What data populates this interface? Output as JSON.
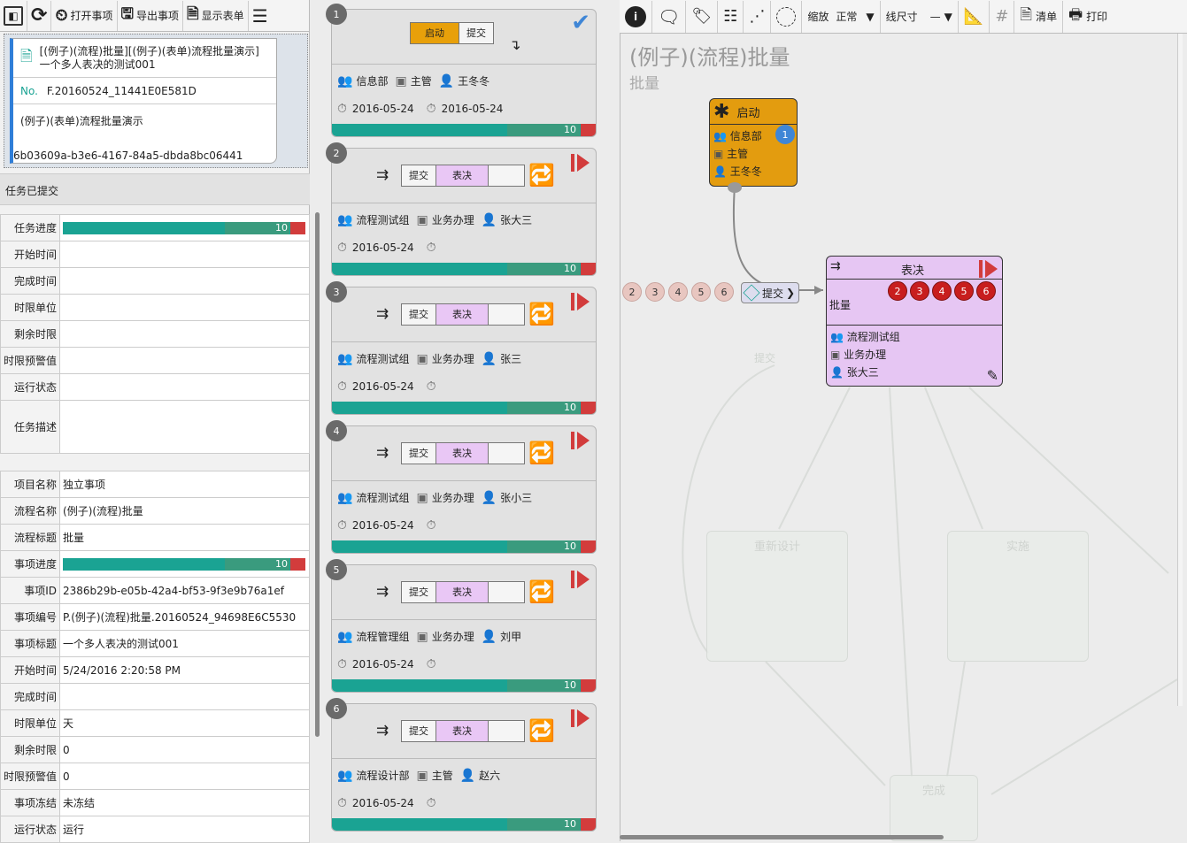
{
  "toolbar": {
    "open": "打开事项",
    "export": "导出事项",
    "show_form": "显示表单"
  },
  "info": {
    "title": "[(例子)(流程)批量][(例子)(表单)流程批量演示]一个多人表决的测试001",
    "no_label": "No.",
    "no": "F.20160524_11441E0E581D",
    "form_name": "(例子)(表单)流程批量演示",
    "guid": "6b03609a-b3e6-4167-84a5-dbda8bc06441"
  },
  "task_status": "任务已提交",
  "task_table": [
    {
      "k": "任务进度",
      "v": "",
      "progress": 10
    },
    {
      "k": "开始时间",
      "v": ""
    },
    {
      "k": "完成时间",
      "v": ""
    },
    {
      "k": "时限单位",
      "v": ""
    },
    {
      "k": "剩余时限",
      "v": ""
    },
    {
      "k": "时限预警值",
      "v": ""
    },
    {
      "k": "运行状态",
      "v": ""
    },
    {
      "k": "任务描述",
      "v": ""
    }
  ],
  "item_table": [
    {
      "k": "项目名称",
      "v": "独立事项"
    },
    {
      "k": "流程名称",
      "v": "(例子)(流程)批量"
    },
    {
      "k": "流程标题",
      "v": "批量"
    },
    {
      "k": "事项进度",
      "v": "",
      "progress": 10
    },
    {
      "k": "事项ID",
      "v": "2386b29b-e05b-42a4-bf53-9f3e9b76a1ef"
    },
    {
      "k": "事项编号",
      "v": "P.(例子)(流程)批量.20160524_94698E6C5530"
    },
    {
      "k": "事项标题",
      "v": "一个多人表决的测试001"
    },
    {
      "k": "开始时间",
      "v": "5/24/2016 2:20:58 PM"
    },
    {
      "k": "完成时间",
      "v": ""
    },
    {
      "k": "时限单位",
      "v": "天"
    },
    {
      "k": "剩余时限",
      "v": "0"
    },
    {
      "k": "时限预警值",
      "v": "0"
    },
    {
      "k": "事项冻结",
      "v": "未冻结"
    },
    {
      "k": "运行状态",
      "v": "运行"
    }
  ],
  "cards": [
    {
      "n": "1",
      "steps": [
        "启动",
        "提交"
      ],
      "dept": "信息部",
      "role": "主管",
      "user": "王冬冬",
      "start": "2016-05-24",
      "end": "2016-05-24",
      "progress": "10",
      "first": true
    },
    {
      "n": "2",
      "steps": [
        "提交",
        "表决",
        ""
      ],
      "dept": "流程测试组",
      "role": "业务办理",
      "user": "张大三",
      "start": "2016-05-24",
      "end": "",
      "progress": "10"
    },
    {
      "n": "3",
      "steps": [
        "提交",
        "表决",
        ""
      ],
      "dept": "流程测试组",
      "role": "业务办理",
      "user": "张三",
      "start": "2016-05-24",
      "end": "",
      "progress": "10"
    },
    {
      "n": "4",
      "steps": [
        "提交",
        "表决",
        ""
      ],
      "dept": "流程测试组",
      "role": "业务办理",
      "user": "张小三",
      "start": "2016-05-24",
      "end": "",
      "progress": "10"
    },
    {
      "n": "5",
      "steps": [
        "提交",
        "表决",
        ""
      ],
      "dept": "流程管理组",
      "role": "业务办理",
      "user": "刘甲",
      "start": "2016-05-24",
      "end": "",
      "progress": "10"
    },
    {
      "n": "6",
      "steps": [
        "提交",
        "表决",
        ""
      ],
      "dept": "流程设计部",
      "role": "主管",
      "user": "赵六",
      "start": "2016-05-24",
      "end": "",
      "progress": "10"
    }
  ],
  "rtool": {
    "zoom_label": "缩放",
    "zoom_value": "正常",
    "line_label": "线尺寸",
    "list": "清单",
    "print": "打印"
  },
  "flow": {
    "title": "(例子)(流程)批量",
    "subtitle": "批量",
    "start_node": {
      "title": "启动",
      "dept": "信息部",
      "role": "主管",
      "user": "王冬冬",
      "badge": "1"
    },
    "vote_node": {
      "title": "表决",
      "label": "批量",
      "dept": "流程测试组",
      "role": "业务办理",
      "user": "张大三",
      "badges": [
        "2",
        "3",
        "4",
        "5",
        "6"
      ]
    },
    "pending": [
      "2",
      "3",
      "4",
      "5",
      "6"
    ],
    "submit": "提交",
    "ghost": {
      "redesign": "重新设计",
      "implement": "实施",
      "done": "完成",
      "submit2": "提交"
    }
  },
  "colors": {
    "teal": "#1aa393",
    "red": "#d23c3c",
    "orange": "#e8a00a",
    "purple": "#e9c7f5"
  }
}
